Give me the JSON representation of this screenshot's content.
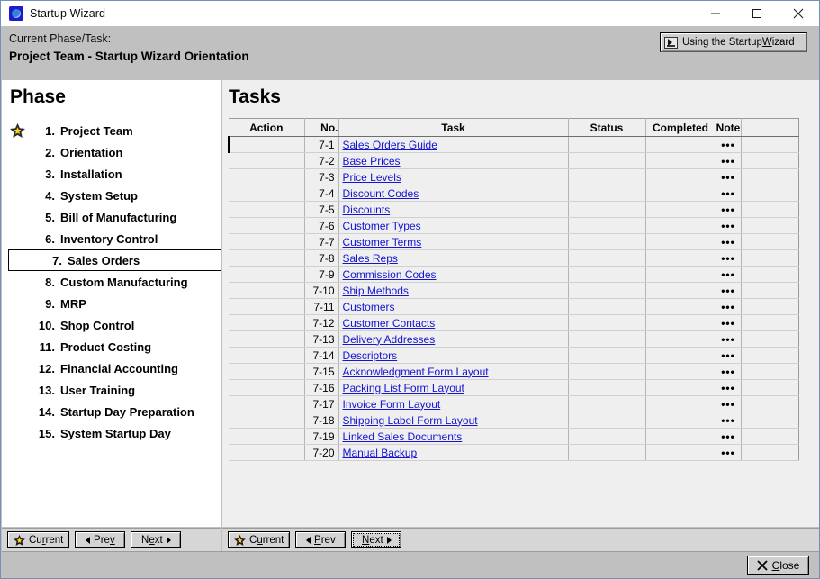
{
  "window": {
    "title": "Startup Wizard",
    "icon": "wizard-app-icon",
    "controls": {
      "minimize": "minimize-icon",
      "maximize": "maximize-icon",
      "close": "close-icon"
    }
  },
  "header": {
    "label": "Current Phase/Task:",
    "value": "Project Team - Startup Wizard Orientation",
    "help_button": {
      "text_before": "Using the Startup ",
      "accel": "W",
      "text_after": "izard",
      "icon": "video-icon"
    }
  },
  "phase_panel": {
    "title": "Phase",
    "selected_index": 6,
    "current_index": 0,
    "items": [
      {
        "num": "1.",
        "label": "Project Team"
      },
      {
        "num": "2.",
        "label": "Orientation"
      },
      {
        "num": "3.",
        "label": "Installation"
      },
      {
        "num": "4.",
        "label": "System Setup"
      },
      {
        "num": "5.",
        "label": "Bill of Manufacturing"
      },
      {
        "num": "6.",
        "label": "Inventory Control"
      },
      {
        "num": "7.",
        "label": "Sales Orders"
      },
      {
        "num": "8.",
        "label": "Custom Manufacturing"
      },
      {
        "num": "9.",
        "label": "MRP"
      },
      {
        "num": "10.",
        "label": "Shop Control"
      },
      {
        "num": "11.",
        "label": "Product Costing"
      },
      {
        "num": "12.",
        "label": "Financial Accounting"
      },
      {
        "num": "13.",
        "label": "User Training"
      },
      {
        "num": "14.",
        "label": "Startup Day Preparation"
      },
      {
        "num": "15.",
        "label": "System Startup Day"
      }
    ]
  },
  "tasks_panel": {
    "title": "Tasks",
    "columns": [
      "Action",
      "No.",
      "Task",
      "Status",
      "Completed",
      "Note",
      ""
    ],
    "selected_row": 0,
    "note_glyph": "•••",
    "rows": [
      {
        "action": "",
        "no": "7-1",
        "task": "Sales Orders Guide",
        "status": "",
        "completed": "",
        "note": "•••"
      },
      {
        "action": "",
        "no": "7-2",
        "task": "Base Prices",
        "status": "",
        "completed": "",
        "note": "•••"
      },
      {
        "action": "",
        "no": "7-3",
        "task": "Price Levels",
        "status": "",
        "completed": "",
        "note": "•••"
      },
      {
        "action": "",
        "no": "7-4",
        "task": "Discount Codes",
        "status": "",
        "completed": "",
        "note": "•••"
      },
      {
        "action": "",
        "no": "7-5",
        "task": "Discounts",
        "status": "",
        "completed": "",
        "note": "•••"
      },
      {
        "action": "",
        "no": "7-6",
        "task": "Customer Types",
        "status": "",
        "completed": "",
        "note": "•••"
      },
      {
        "action": "",
        "no": "7-7",
        "task": "Customer Terms",
        "status": "",
        "completed": "",
        "note": "•••"
      },
      {
        "action": "",
        "no": "7-8",
        "task": "Sales Reps",
        "status": "",
        "completed": "",
        "note": "•••"
      },
      {
        "action": "",
        "no": "7-9",
        "task": "Commission Codes",
        "status": "",
        "completed": "",
        "note": "•••"
      },
      {
        "action": "",
        "no": "7-10",
        "task": "Ship Methods",
        "status": "",
        "completed": "",
        "note": "•••"
      },
      {
        "action": "",
        "no": "7-11",
        "task": "Customers",
        "status": "",
        "completed": "",
        "note": "•••"
      },
      {
        "action": "",
        "no": "7-12",
        "task": "Customer Contacts",
        "status": "",
        "completed": "",
        "note": "•••"
      },
      {
        "action": "",
        "no": "7-13",
        "task": "Delivery Addresses",
        "status": "",
        "completed": "",
        "note": "•••"
      },
      {
        "action": "",
        "no": "7-14",
        "task": "Descriptors",
        "status": "",
        "completed": "",
        "note": "•••"
      },
      {
        "action": "",
        "no": "7-15",
        "task": "Acknowledgment Form Layout",
        "status": "",
        "completed": "",
        "note": "•••"
      },
      {
        "action": "",
        "no": "7-16",
        "task": "Packing List Form Layout",
        "status": "",
        "completed": "",
        "note": "•••"
      },
      {
        "action": "",
        "no": "7-17",
        "task": "Invoice Form Layout",
        "status": "",
        "completed": "",
        "note": "•••"
      },
      {
        "action": "",
        "no": "7-18",
        "task": "Shipping Label Form Layout",
        "status": "",
        "completed": "",
        "note": "•••"
      },
      {
        "action": "",
        "no": "7-19",
        "task": "Linked Sales Documents",
        "status": "",
        "completed": "",
        "note": "•••"
      },
      {
        "action": "",
        "no": "7-20",
        "task": "Manual Backup",
        "status": "",
        "completed": "",
        "note": "•••"
      }
    ]
  },
  "phase_nav": {
    "current": {
      "text_before": "Cu",
      "accel": "r",
      "text_after": "rent"
    },
    "prev": {
      "text_before": "Pre",
      "accel": "v",
      "text_after": ""
    },
    "next": {
      "text_before": "N",
      "accel": "e",
      "text_after": "xt"
    }
  },
  "task_nav": {
    "current": {
      "text_before": "C",
      "accel": "u",
      "text_after": "rrent"
    },
    "prev": {
      "text_before": "",
      "accel": "P",
      "text_after": "rev"
    },
    "next": {
      "text_before": "",
      "accel": "N",
      "text_after": "ext"
    },
    "focused": "next"
  },
  "footer": {
    "close": {
      "text_before": "",
      "accel": "C",
      "text_after": "lose",
      "icon": "x-icon"
    }
  },
  "colors": {
    "chrome": "#c0c0c0",
    "panel": "#efefef",
    "link": "#1414d2",
    "star": "#ffd21e",
    "window_border": "#6f93b8"
  }
}
